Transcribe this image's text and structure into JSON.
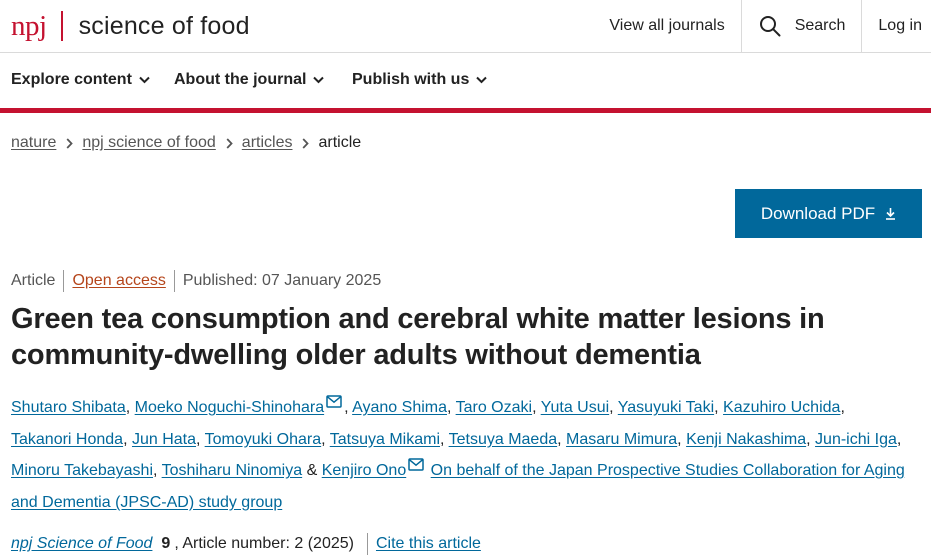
{
  "brand": {
    "publisher": "npj",
    "journal": "science of food"
  },
  "header": {
    "view_all": "View all journals",
    "search": "Search",
    "login": "Log in"
  },
  "nav": {
    "items": [
      {
        "label": "Explore content"
      },
      {
        "label": "About the journal"
      },
      {
        "label": "Publish with us"
      }
    ]
  },
  "breadcrumb": {
    "items": [
      "nature",
      "npj science of food",
      "articles"
    ],
    "current": "article",
    "separator_icon": "chevron-right-icon"
  },
  "download": {
    "label": "Download PDF",
    "icon": "download-icon"
  },
  "article": {
    "type": "Article",
    "access": "Open access",
    "published": "Published: 07 January 2025",
    "title": "Green tea consumption and cerebral white matter lesions in community-dwelling older adults without dementia"
  },
  "authors": {
    "names": [
      "Shutaro Shibata",
      "Moeko Noguchi-Shinohara",
      "Ayano Shima",
      "Taro Ozaki",
      "Yuta Usui",
      "Yasuyuki Taki",
      "Kazuhiro Uchida",
      "Takanori Honda",
      "Jun Hata",
      "Tomoyuki Ohara",
      "Tatsuya Mikami",
      "Tetsuya Maeda",
      "Masaru Mimura",
      "Kenji Nakashima",
      "Jun-ichi Iga",
      "Minoru Takebayashi",
      "Toshiharu Ninomiya",
      "Kenjiro Ono"
    ],
    "comma": ",",
    "ampersand": "&",
    "group": "On behalf of the Japan Prospective Studies Collaboration for Aging and Dementia (JPSC-AD) study group"
  },
  "citation": {
    "journal": "npj Science of Food",
    "volume": "9",
    "article_number": ", Article number: 2 (2025)",
    "cite_label": "Cite this article"
  },
  "colors": {
    "brand_red": "#c41230",
    "link_blue": "#01689b",
    "open_access": "#b5451b"
  }
}
